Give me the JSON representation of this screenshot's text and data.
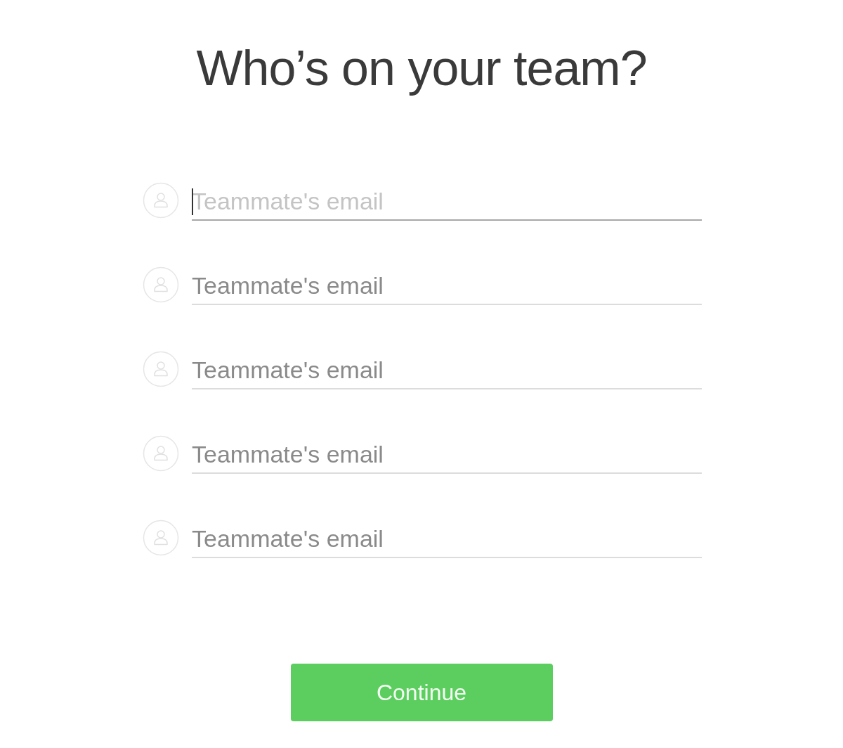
{
  "title": "Who’s on your team?",
  "fields": [
    {
      "placeholder": "Teammate's email",
      "focused": true
    },
    {
      "placeholder": "Teammate's email",
      "focused": false
    },
    {
      "placeholder": "Teammate's email",
      "focused": false
    },
    {
      "placeholder": "Teammate's email",
      "focused": false
    },
    {
      "placeholder": "Teammate's email",
      "focused": false
    }
  ],
  "button": "Continue"
}
